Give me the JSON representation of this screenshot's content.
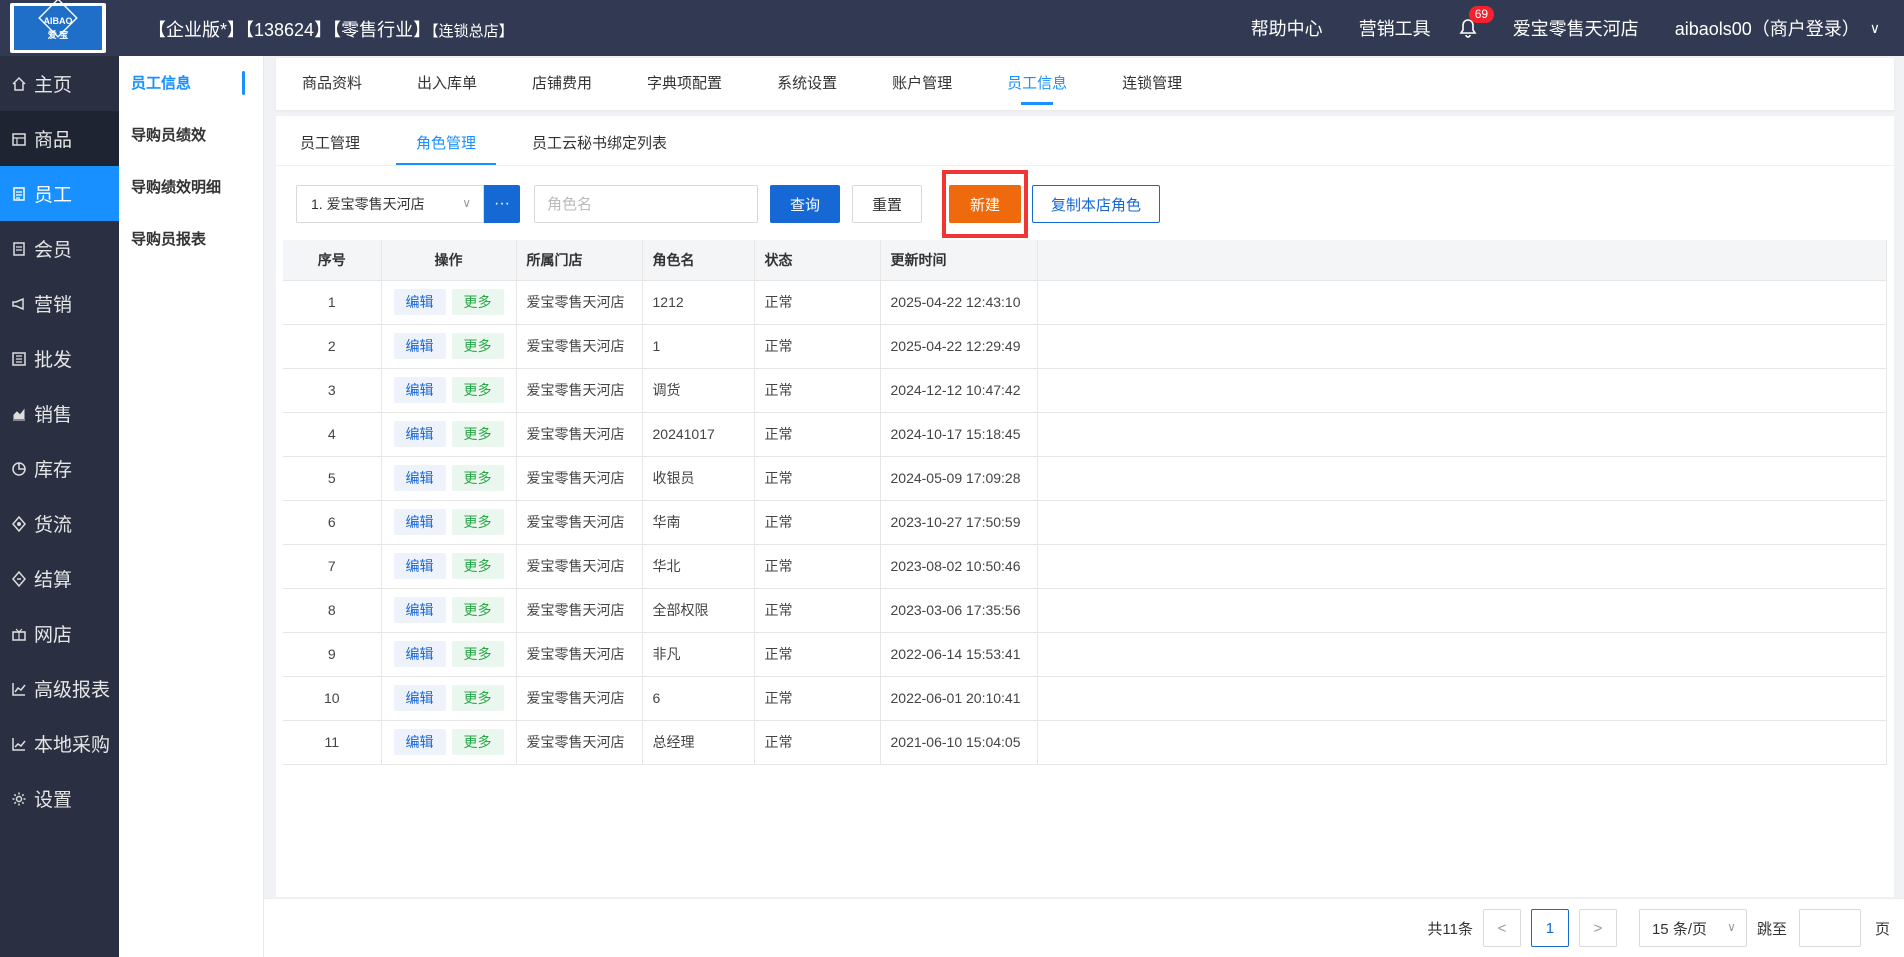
{
  "header": {
    "title_main": "【企业版*】【138624】【零售行业】",
    "title_sub": "【连锁总店】",
    "logo_text1": "AIBAO",
    "logo_text2": "爱 宝",
    "help": "帮助中心",
    "marketing_tools": "营销工具",
    "notification_count": "69",
    "store_name": "爱宝零售天河店",
    "user": "aibaols00（商户登录）",
    "user_chevron": "∨"
  },
  "sidebar": {
    "items": [
      {
        "label": "主页",
        "icon": "home-icon"
      },
      {
        "label": "商品",
        "icon": "product-icon"
      },
      {
        "label": "员工",
        "icon": "staff-icon"
      },
      {
        "label": "会员",
        "icon": "member-icon"
      },
      {
        "label": "营销",
        "icon": "megaphone-icon"
      },
      {
        "label": "批发",
        "icon": "wholesale-icon"
      },
      {
        "label": "销售",
        "icon": "sales-chart-icon"
      },
      {
        "label": "库存",
        "icon": "pie-icon"
      },
      {
        "label": "货流",
        "icon": "flow-icon"
      },
      {
        "label": "结算",
        "icon": "settle-icon"
      },
      {
        "label": "网店",
        "icon": "gift-icon"
      },
      {
        "label": "高级报表",
        "icon": "line-chart-icon"
      },
      {
        "label": "本地采购",
        "icon": "trend-icon"
      },
      {
        "label": "设置",
        "icon": "gear-icon"
      }
    ]
  },
  "subsidebar": {
    "items": [
      "员工信息",
      "导购员绩效",
      "导购绩效明细",
      "导购员报表"
    ]
  },
  "top_tabs": [
    "商品资料",
    "出入库单",
    "店铺费用",
    "字典项配置",
    "系统设置",
    "账户管理",
    "员工信息",
    "连锁管理"
  ],
  "inner_tabs": [
    "员工管理",
    "角色管理",
    "员工云秘书绑定列表"
  ],
  "toolbar": {
    "store_value": "1. 爱宝零售天河店",
    "dots": "···",
    "role_placeholder": "角色名",
    "query": "查询",
    "reset": "重置",
    "new": "新建",
    "copy": "复制本店角色"
  },
  "table": {
    "headers": [
      "序号",
      "操作",
      "所属门店",
      "角色名",
      "状态",
      "更新时间"
    ],
    "edit_label": "编辑",
    "more_label": "更多",
    "rows": [
      {
        "no": "1",
        "store": "爱宝零售天河店",
        "role": "1212",
        "status": "正常",
        "time": "2025-04-22 12:43:10"
      },
      {
        "no": "2",
        "store": "爱宝零售天河店",
        "role": "1",
        "status": "正常",
        "time": "2025-04-22 12:29:49"
      },
      {
        "no": "3",
        "store": "爱宝零售天河店",
        "role": "调货",
        "status": "正常",
        "time": "2024-12-12 10:47:42"
      },
      {
        "no": "4",
        "store": "爱宝零售天河店",
        "role": "20241017",
        "status": "正常",
        "time": "2024-10-17 15:18:45"
      },
      {
        "no": "5",
        "store": "爱宝零售天河店",
        "role": "收银员",
        "status": "正常",
        "time": "2024-05-09 17:09:28"
      },
      {
        "no": "6",
        "store": "爱宝零售天河店",
        "role": "华南",
        "status": "正常",
        "time": "2023-10-27 17:50:59"
      },
      {
        "no": "7",
        "store": "爱宝零售天河店",
        "role": "华北",
        "status": "正常",
        "time": "2023-08-02 10:50:46"
      },
      {
        "no": "8",
        "store": "爱宝零售天河店",
        "role": "全部权限",
        "status": "正常",
        "time": "2023-03-06 17:35:56"
      },
      {
        "no": "9",
        "store": "爱宝零售天河店",
        "role": "非凡",
        "status": "正常",
        "time": "2022-06-14 15:53:41"
      },
      {
        "no": "10",
        "store": "爱宝零售天河店",
        "role": "6",
        "status": "正常",
        "time": "2022-06-01 20:10:41"
      },
      {
        "no": "11",
        "store": "爱宝零售天河店",
        "role": "总经理",
        "status": "正常",
        "time": "2021-06-10 15:04:05"
      }
    ]
  },
  "pagination": {
    "total": "共11条",
    "prev": "<",
    "current": "1",
    "next": ">",
    "page_size": "15 条/页",
    "jump_label": "跳至",
    "page_unit": "页"
  },
  "colors": {
    "header_bg": "#313a52",
    "sidebar_bg": "#2a3042",
    "accent": "#1890ff",
    "primary_btn": "#1668d4",
    "new_btn": "#ef6a0c",
    "highlight_box": "#f13535"
  }
}
